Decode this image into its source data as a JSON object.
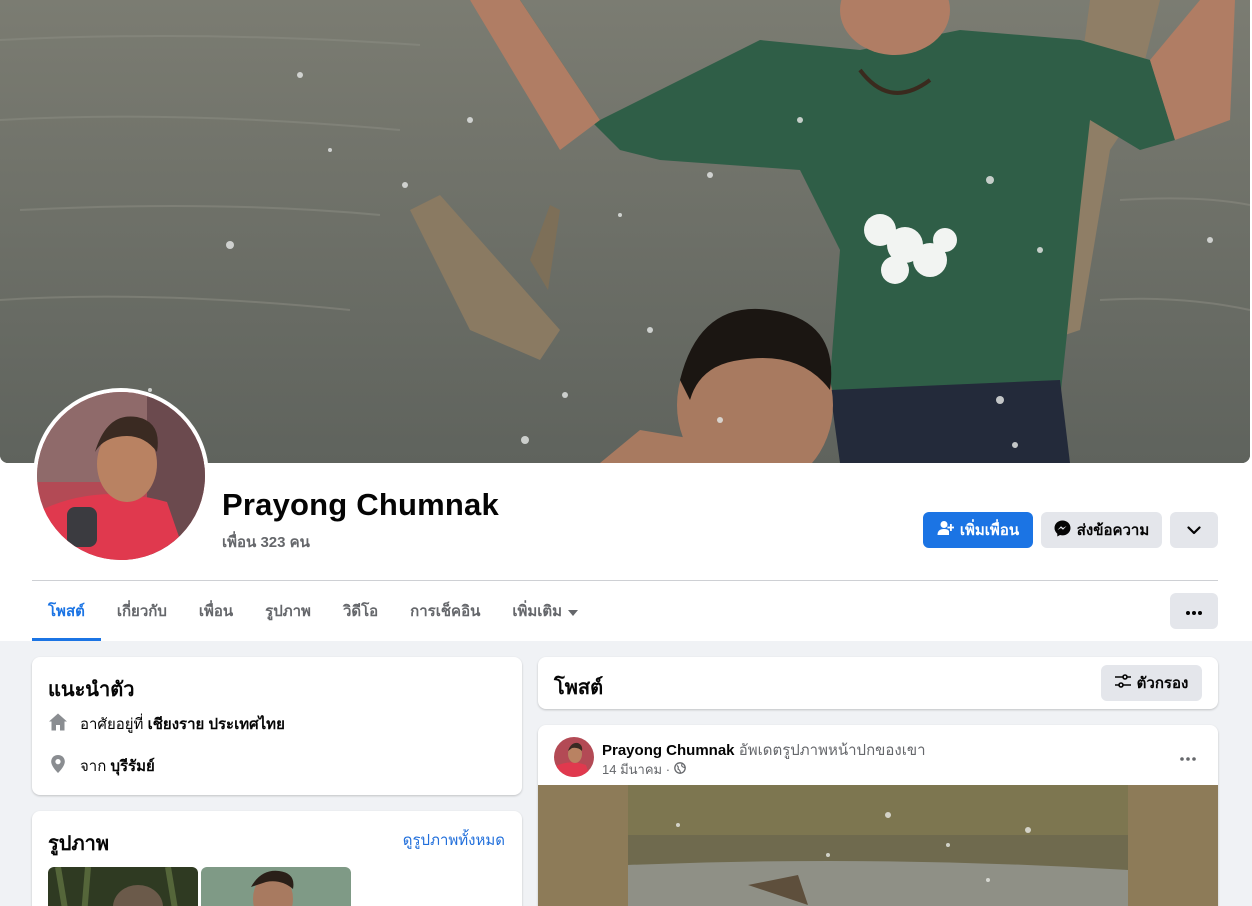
{
  "profile": {
    "name": "Prayong Chumnak",
    "friends_count": "เพื่อน 323 คน"
  },
  "actions": {
    "add_friend": "เพิ่มเพื่อน",
    "message": "ส่งข้อความ"
  },
  "tabs": [
    {
      "label": "โพสต์",
      "active": true
    },
    {
      "label": "เกี่ยวกับ"
    },
    {
      "label": "เพื่อน"
    },
    {
      "label": "รูปภาพ"
    },
    {
      "label": "วิดีโอ"
    },
    {
      "label": "การเช็คอิน"
    },
    {
      "label": "เพิ่มเติม"
    }
  ],
  "intro": {
    "title": "แนะนำตัว",
    "lives_prefix": "อาศัยอยู่ที่",
    "lives_value": "เชียงราย ประเทศไทย",
    "from_prefix": "จาก",
    "from_value": "บุรีรัมย์"
  },
  "photos": {
    "title": "รูปภาพ",
    "see_all": "ดูรูปภาพทั้งหมด"
  },
  "posts": {
    "title": "โพสต์",
    "filter": "ตัวกรอง",
    "first": {
      "author": "Prayong Chumnak",
      "action": "อัพเดตรูปภาพหน้าปกของเขา",
      "time": "14 มีนาคม ·"
    }
  },
  "colors": {
    "primary": "#1b74e4",
    "secondary_bg": "#e4e6eb",
    "page_bg": "#f0f2f5",
    "muted_text": "#65676b"
  }
}
